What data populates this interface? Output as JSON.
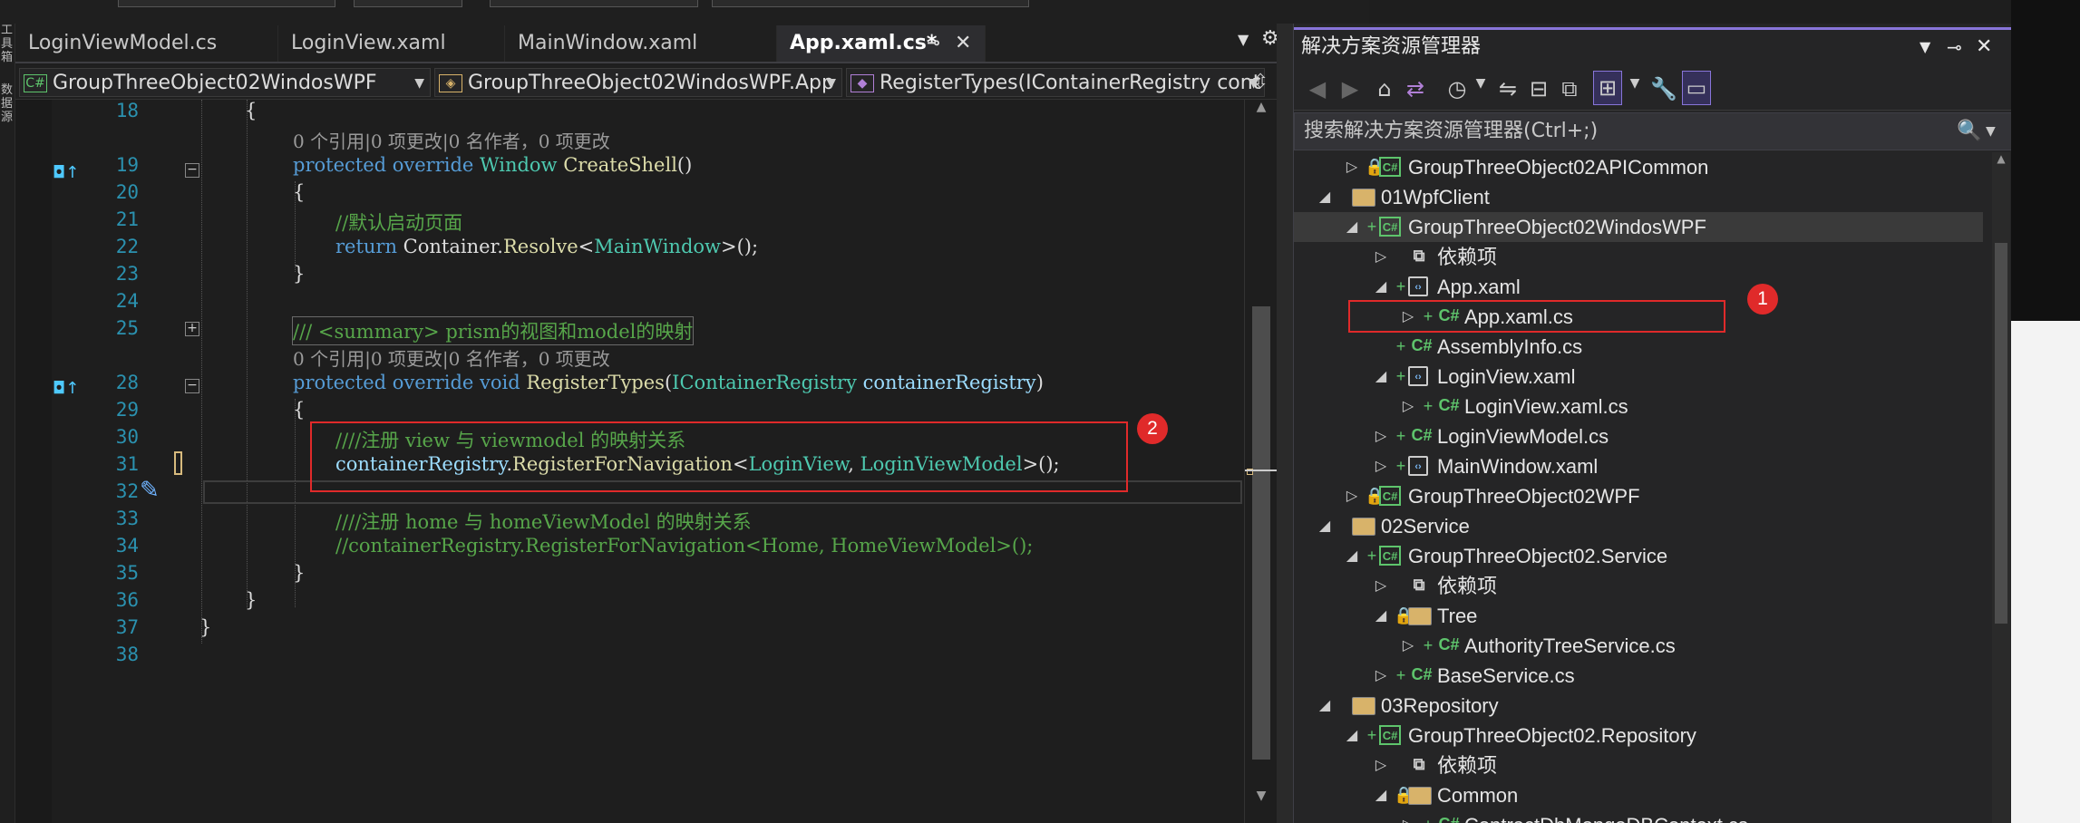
{
  "tabs": [
    {
      "label": "LoginViewModel.cs"
    },
    {
      "label": "LoginView.xaml"
    },
    {
      "label": "MainWindow.xaml"
    },
    {
      "label": "App.xaml.cs*",
      "active": true
    }
  ],
  "tab_icons": {
    "pin": "pin-icon",
    "close": "close-icon",
    "overflow": "chevron-down-icon",
    "settings": "gear-icon"
  },
  "left_strip": {
    "item1": "工具箱",
    "item2": "数据源"
  },
  "breadcrumbs": {
    "project": "GroupThreeObject02WindosWPF",
    "class": "GroupThreeObject02WindosWPF.App",
    "member": "RegisterTypes(IContainerRegistry cont",
    "csharp_badge": "C#"
  },
  "editor": {
    "hint1": "0 个引用|0 项更改|0 名作者，0 项更改",
    "hint2": "0 个引用|0 项更改|0 名作者，0 项更改",
    "lines": [
      {
        "n": "18",
        "parts": [
          {
            "c": "",
            "t": "{"
          }
        ]
      },
      {
        "n": "19",
        "parts": [
          {
            "c": "kw",
            "t": "protected override "
          },
          {
            "c": "ty",
            "t": "Window "
          },
          {
            "c": "me",
            "t": "CreateShell"
          },
          {
            "c": "",
            "t": "()"
          }
        ]
      },
      {
        "n": "20",
        "parts": [
          {
            "c": "",
            "t": "{"
          }
        ]
      },
      {
        "n": "21",
        "parts": [
          {
            "c": "cm",
            "t": "//默认启动页面"
          }
        ]
      },
      {
        "n": "22",
        "parts": [
          {
            "c": "kw",
            "t": "return "
          },
          {
            "c": "",
            "t": "Container."
          },
          {
            "c": "me",
            "t": "Resolve"
          },
          {
            "c": "",
            "t": "<"
          },
          {
            "c": "ty",
            "t": "MainWindow"
          },
          {
            "c": "",
            "t": ">();"
          }
        ]
      },
      {
        "n": "23",
        "parts": [
          {
            "c": "",
            "t": "}"
          }
        ]
      },
      {
        "n": "24",
        "parts": []
      },
      {
        "n": "25",
        "parts": [
          {
            "c": "cm",
            "t": "/// <summary> prism的视图和model的映射"
          }
        ]
      },
      {
        "n": "28",
        "parts": [
          {
            "c": "kw",
            "t": "protected override void "
          },
          {
            "c": "me",
            "t": "RegisterTypes"
          },
          {
            "c": "",
            "t": "("
          },
          {
            "c": "ty",
            "t": "IContainerRegistry "
          },
          {
            "c": "pr",
            "t": "containerRegistry"
          },
          {
            "c": "",
            "t": ")"
          }
        ]
      },
      {
        "n": "29",
        "parts": [
          {
            "c": "",
            "t": "{"
          }
        ]
      },
      {
        "n": "30",
        "parts": [
          {
            "c": "cm",
            "t": "////注册 view 与 viewmodel 的映射关系"
          }
        ]
      },
      {
        "n": "31",
        "parts": [
          {
            "c": "pr",
            "t": "containerRegistry"
          },
          {
            "c": "",
            "t": "."
          },
          {
            "c": "me",
            "t": "RegisterForNavigation"
          },
          {
            "c": "",
            "t": "<"
          },
          {
            "c": "ty",
            "t": "LoginView"
          },
          {
            "c": "",
            "t": ", "
          },
          {
            "c": "ty",
            "t": "LoginViewModel"
          },
          {
            "c": "",
            "t": ">();"
          }
        ]
      },
      {
        "n": "32",
        "parts": []
      },
      {
        "n": "33",
        "parts": [
          {
            "c": "cm",
            "t": "////注册 home 与 homeViewModel 的映射关系"
          }
        ]
      },
      {
        "n": "34",
        "parts": [
          {
            "c": "cm",
            "t": "//containerRegistry.RegisterForNavigation<Home, HomeViewModel>();"
          }
        ]
      },
      {
        "n": "35",
        "parts": [
          {
            "c": "",
            "t": "}"
          }
        ]
      },
      {
        "n": "36",
        "parts": [
          {
            "c": "",
            "t": "}"
          }
        ]
      },
      {
        "n": "37",
        "parts": [
          {
            "c": "",
            "t": "}"
          }
        ]
      },
      {
        "n": "38",
        "parts": []
      }
    ],
    "badge2": "2"
  },
  "solution_explorer": {
    "title": "解决方案资源管理器",
    "search_placeholder": "搜索解决方案资源管理器(Ctrl+;)",
    "badge1": "1",
    "tree": [
      {
        "label": "GroupThreeObject02APICommon",
        "indent": 1,
        "arrow": "▷",
        "pre": "lock",
        "icon": "proj"
      },
      {
        "label": "01WpfClient",
        "indent": 0,
        "arrow": "◢",
        "pre": "",
        "icon": "fold"
      },
      {
        "label": "GroupThreeObject02WindosWPF",
        "indent": 1,
        "arrow": "◢",
        "pre": "plus",
        "icon": "proj",
        "highlight": true
      },
      {
        "label": "依赖项",
        "indent": 2,
        "arrow": "▷",
        "pre": "",
        "icon": "dep"
      },
      {
        "label": "App.xaml",
        "indent": 2,
        "arrow": "◢",
        "pre": "plus",
        "icon": "xaml"
      },
      {
        "label": "App.xaml.cs",
        "indent": 3,
        "arrow": "▷",
        "pre": "plus",
        "icon": "cs",
        "boxed": true
      },
      {
        "label": "AssemblyInfo.cs",
        "indent": 2,
        "arrow": "",
        "pre": "plus",
        "icon": "cs"
      },
      {
        "label": "LoginView.xaml",
        "indent": 2,
        "arrow": "◢",
        "pre": "plus",
        "icon": "xaml"
      },
      {
        "label": "LoginView.xaml.cs",
        "indent": 3,
        "arrow": "▷",
        "pre": "plus",
        "icon": "cs"
      },
      {
        "label": "LoginViewModel.cs",
        "indent": 2,
        "arrow": "▷",
        "pre": "plus",
        "icon": "cs"
      },
      {
        "label": "MainWindow.xaml",
        "indent": 2,
        "arrow": "▷",
        "pre": "plus",
        "icon": "xaml"
      },
      {
        "label": "GroupThreeObject02WPF",
        "indent": 1,
        "arrow": "▷",
        "pre": "lock",
        "icon": "proj"
      },
      {
        "label": "02Service",
        "indent": 0,
        "arrow": "◢",
        "pre": "",
        "icon": "fold"
      },
      {
        "label": "GroupThreeObject02.Service",
        "indent": 1,
        "arrow": "◢",
        "pre": "plus",
        "icon": "proj"
      },
      {
        "label": "依赖项",
        "indent": 2,
        "arrow": "▷",
        "pre": "",
        "icon": "dep"
      },
      {
        "label": "Tree",
        "indent": 2,
        "arrow": "◢",
        "pre": "lock",
        "icon": "fold"
      },
      {
        "label": "AuthorityTreeService.cs",
        "indent": 3,
        "arrow": "▷",
        "pre": "plus",
        "icon": "cs"
      },
      {
        "label": "BaseService.cs",
        "indent": 2,
        "arrow": "▷",
        "pre": "plus",
        "icon": "cs"
      },
      {
        "label": "03Repository",
        "indent": 0,
        "arrow": "◢",
        "pre": "",
        "icon": "fold"
      },
      {
        "label": "GroupThreeObject02.Repository",
        "indent": 1,
        "arrow": "◢",
        "pre": "plus",
        "icon": "proj"
      },
      {
        "label": "依赖项",
        "indent": 2,
        "arrow": "▷",
        "pre": "",
        "icon": "dep"
      },
      {
        "label": "Common",
        "indent": 2,
        "arrow": "◢",
        "pre": "lock",
        "icon": "fold"
      },
      {
        "label": "ContractDbMongoDBContext.cs",
        "indent": 3,
        "arrow": "▷",
        "pre": "plus",
        "icon": "cs"
      }
    ]
  },
  "colors": {
    "accent": "#8875d9",
    "annotation_red": "#e02a2a",
    "keyword": "#569cd6",
    "type": "#4ec9b0",
    "comment": "#57a64a"
  }
}
